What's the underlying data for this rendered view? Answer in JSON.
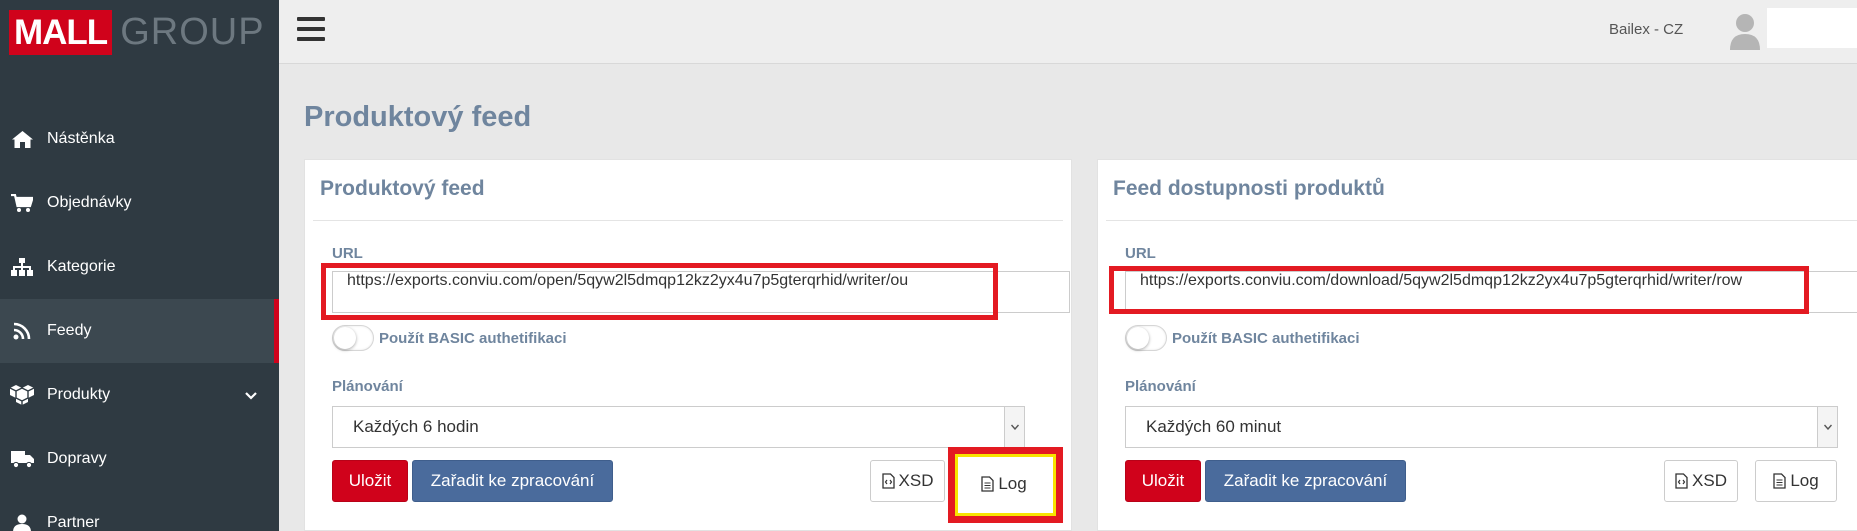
{
  "brand": {
    "mall": "MALL",
    "group": "GROUP"
  },
  "topbar": {
    "user_name": "Bailex - CZ"
  },
  "sidebar": {
    "items": [
      {
        "label": "Nástěnka",
        "icon": "home-icon"
      },
      {
        "label": "Objednávky",
        "icon": "cart-icon"
      },
      {
        "label": "Kategorie",
        "icon": "sitemap-icon"
      },
      {
        "label": "Feedy",
        "icon": "rss-icon",
        "active": true
      },
      {
        "label": "Produkty",
        "icon": "cubes-icon",
        "has_submenu": true
      },
      {
        "label": "Dopravy",
        "icon": "truck-icon"
      },
      {
        "label": "Partner",
        "icon": "user-icon"
      }
    ]
  },
  "page": {
    "title": "Produktový feed"
  },
  "panels": [
    {
      "title": "Produktový feed",
      "url_label": "URL",
      "url_value": "https://exports.conviu.com/open/5qyw2l5dmqp12kz2yx4u7p5gterqrhid/writer/ou",
      "basic_auth_label": "Použít BASIC authetifikaci",
      "schedule_label": "Plánování",
      "schedule_value": "Každých 6 hodin",
      "save_label": "Uložit",
      "queue_label": "Zařadit ke zpracování",
      "xsd_label": "XSD",
      "log_label": "Log"
    },
    {
      "title": "Feed dostupnosti produktů",
      "url_label": "URL",
      "url_value": "https://exports.conviu.com/download/5qyw2l5dmqp12kz2yx4u7p5gterqrhid/writer/row",
      "basic_auth_label": "Použít BASIC authetifikaci",
      "schedule_label": "Plánování",
      "schedule_value": "Každých 60 minut",
      "save_label": "Uložit",
      "queue_label": "Zařadit ke zpracování",
      "xsd_label": "XSD",
      "log_label": "Log"
    }
  ],
  "colors": {
    "sidebar_bg": "#2f3a42",
    "brand_red": "#d0021b",
    "heading_blue": "#6f859e",
    "button_blue": "#4a6b9c",
    "highlight_red": "#e31a22",
    "highlight_yellow": "#f7e400"
  }
}
